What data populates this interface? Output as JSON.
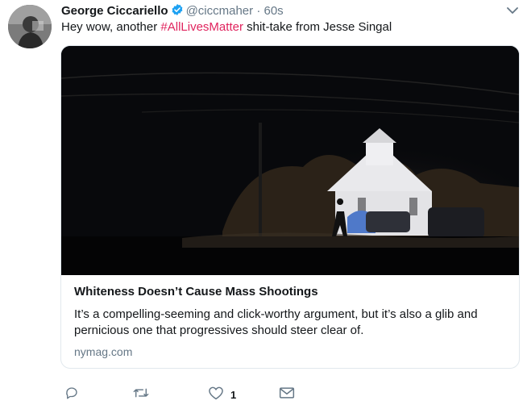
{
  "tweet": {
    "author_name": "George Ciccariello",
    "handle": "@ciccmaher",
    "dot": "·",
    "time": "60s",
    "text_before": "Hey wow, another ",
    "hashtag": "#AllLivesMatter",
    "text_after": " shit-take from Jesse Singal",
    "verified": true
  },
  "card": {
    "title": "Whiteness Doesn’t Cause Mass Shootings",
    "description": "It’s a compelling-seeming and click-worthy argument, but it’s also a glib and pernicious one that progressives should steer clear of.",
    "domain": "nymag.com"
  },
  "actions": {
    "reply_icon": "reply-icon",
    "retweet_icon": "retweet-icon",
    "like_icon": "heart-icon",
    "like_count": "1",
    "dm_icon": "mail-icon"
  },
  "colors": {
    "accent": "#1da1f2",
    "hashtag": "#e0245e",
    "secondary_text": "#657786",
    "border": "#e1e8ed"
  }
}
